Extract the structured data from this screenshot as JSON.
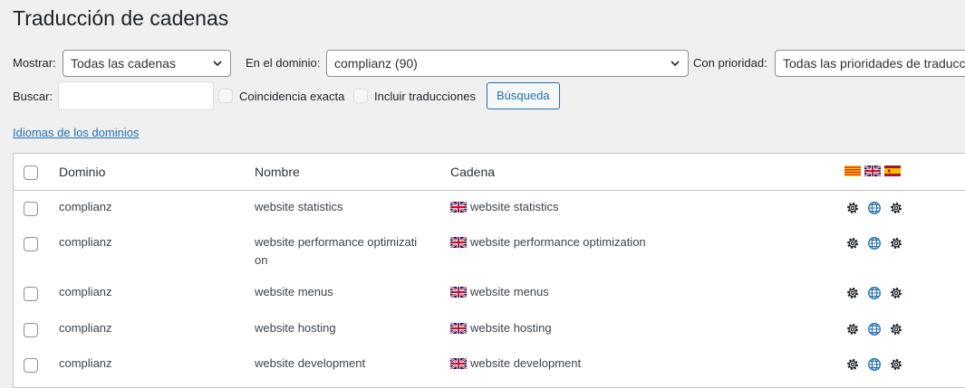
{
  "page": {
    "title": "Traducción de cadenas"
  },
  "filters": {
    "show_label": "Mostrar:",
    "show_value": "Todas las cadenas",
    "domain_label": "En el dominio:",
    "domain_value": "complianz (90)",
    "priority_label": "Con prioridad:",
    "priority_value": "Todas las prioridades de traducción",
    "search_label": "Buscar:",
    "search_value": "",
    "exact_match_label": "Coincidencia exacta",
    "include_translations_label": "Incluir traducciones",
    "search_button": "Búsqueda"
  },
  "domain_languages_link": "Idiomas de los dominios",
  "table": {
    "headers": {
      "domain": "Dominio",
      "name": "Nombre",
      "string": "Cadena"
    },
    "header_flags": [
      "catalan-flag-icon",
      "uk-flag-icon",
      "spain-flag-icon"
    ],
    "rows": [
      {
        "domain": "complianz",
        "name": "website statistics",
        "string": "website statistics"
      },
      {
        "domain": "complianz",
        "name": "website performance optimizati\non",
        "string": "website performance optimization"
      },
      {
        "domain": "complianz",
        "name": "website menus",
        "string": "website menus"
      },
      {
        "domain": "complianz",
        "name": "website hosting",
        "string": "website hosting"
      },
      {
        "domain": "complianz",
        "name": "website development",
        "string": "website development"
      }
    ]
  },
  "colors": {
    "accent": "#2271b1",
    "globe": "#2271b1"
  }
}
